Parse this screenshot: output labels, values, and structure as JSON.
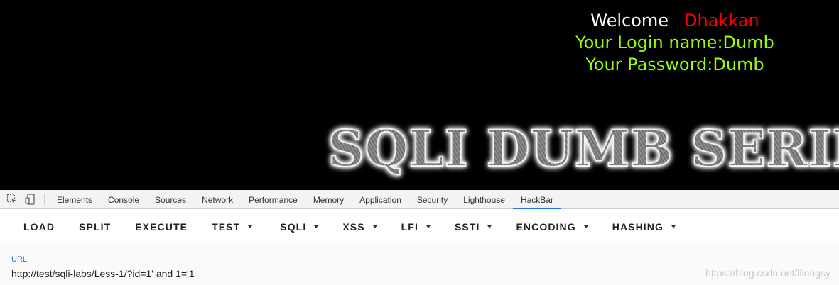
{
  "page": {
    "welcome": {
      "label": "Welcome",
      "name": "Dhakkan"
    },
    "login_line": "Your Login name:Dumb",
    "password_line": "Your Password:Dumb",
    "banner": "SQLI DUMB SERIES",
    "colors": {
      "welcome": "#ffffff",
      "name": "#ff0000",
      "info": "#99ff00",
      "background": "#000000"
    }
  },
  "devtools": {
    "icons": [
      "inspect-element-icon",
      "device-toolbar-icon"
    ],
    "tabs": [
      "Elements",
      "Console",
      "Sources",
      "Network",
      "Performance",
      "Memory",
      "Application",
      "Security",
      "Lighthouse",
      "HackBar"
    ],
    "active_tab": "HackBar",
    "accent": "#1a73e8"
  },
  "hackbar": {
    "buttons": {
      "load": "LOAD",
      "split": "SPLIT",
      "execute": "EXECUTE",
      "test": "TEST",
      "sqli": "SQLI",
      "xss": "XSS",
      "lfi": "LFI",
      "ssti": "SSTI",
      "encoding": "ENCODING",
      "hashing": "HASHING"
    },
    "url_label": "URL",
    "url_value": "http://test/sqli-labs/Less-1/?id=1' and 1='1",
    "watermark": "https://blog.csdn.net/lilongsy"
  }
}
